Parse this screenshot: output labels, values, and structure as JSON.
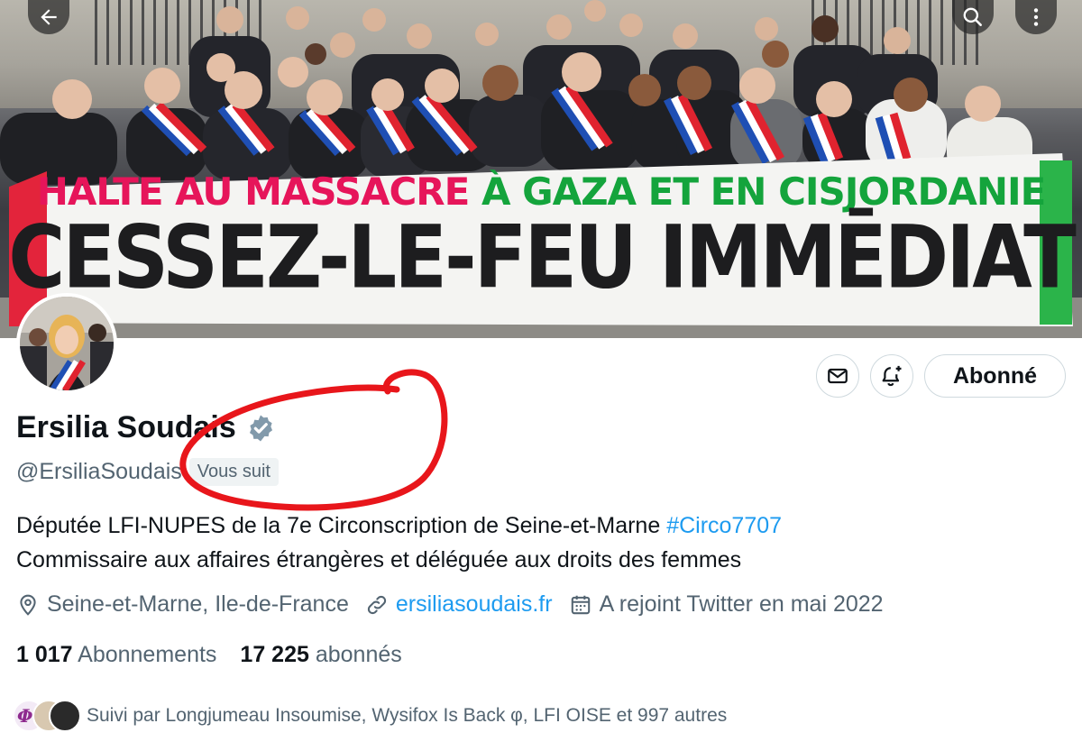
{
  "banner": {
    "line1_part1": "HALTE AU MASSACRE",
    "line1_part2": "À GAZA ET EN CISJORDANIE",
    "line2": "CESSEZ-LE-FEU IMMĒDIAT"
  },
  "nav": {
    "back_icon": "arrow-left-icon",
    "search_icon": "search-icon",
    "more_icon": "more-vertical-icon"
  },
  "actions": {
    "message_icon": "envelope-icon",
    "notify_icon": "bell-plus-icon",
    "follow_label": "Abonné"
  },
  "profile": {
    "display_name": "Ersilia Soudais",
    "verified_icon": "verified-badge-icon",
    "handle": "@ErsiliaSoudais",
    "follows_you": "Vous suit",
    "bio_text": "Députée LFI-NUPES de la 7e Circonscription de Seine-et-Marne",
    "bio_hashtag": "#Circo7707",
    "bio_line2": "Commissaire aux affaires étrangères et déléguée aux droits des femmes",
    "location": "Seine-et-Marne, Ile-de-France",
    "website": "ersiliasoudais.fr",
    "joined": "A rejoint Twitter en mai 2022"
  },
  "stats": {
    "following_count": "1 017",
    "following_label": "Abonnements",
    "followers_count": "17 225",
    "followers_label": "abonnés"
  },
  "followed_by": {
    "text": "Suivi par Longjumeau Insoumise, Wysifox Is Back φ, LFI OISE et 997 autres"
  },
  "colors": {
    "link": "#1d9bf0",
    "secondary_text": "#536471",
    "annotation_red": "#e8161b",
    "verified": "#829aab"
  }
}
